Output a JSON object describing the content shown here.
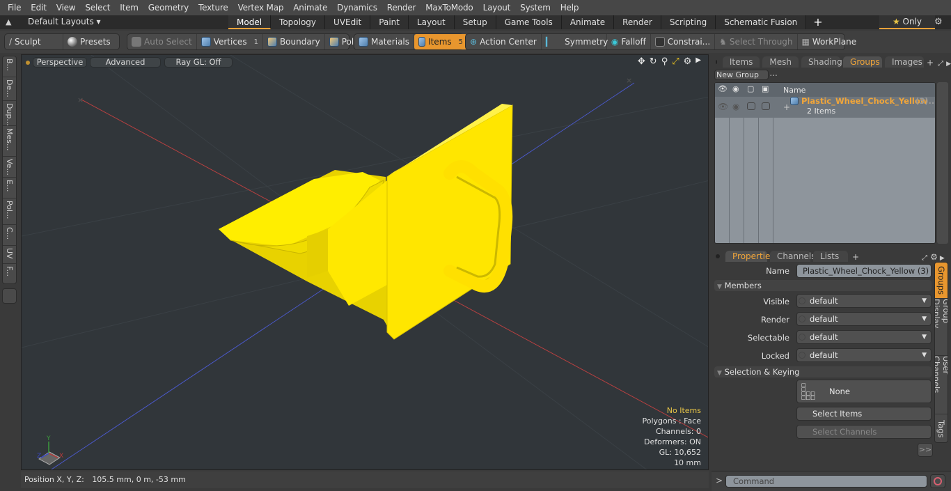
{
  "menu": [
    "File",
    "Edit",
    "View",
    "Select",
    "Item",
    "Geometry",
    "Texture",
    "Vertex Map",
    "Animate",
    "Dynamics",
    "Render",
    "MaxToModo",
    "Layout",
    "System",
    "Help"
  ],
  "layoutbar": {
    "layouts_label": "Default Layouts ▾",
    "tabs": [
      "Model",
      "Topology",
      "UVEdit",
      "Paint",
      "Layout",
      "Setup",
      "Game Tools",
      "Animate",
      "Render",
      "Scripting",
      "Schematic Fusion"
    ],
    "active_tab": "Model",
    "add_tab": "+",
    "only_label": "Only"
  },
  "toolbar": {
    "sculpt": "Sculpt",
    "presets": "Presets",
    "auto_select": "Auto Select",
    "vertices": "Vertices",
    "vertices_count": "1",
    "boundary": "Boundary",
    "polygons": "Polygons",
    "materials": "Materials",
    "items": "Items",
    "items_count": "5",
    "action_center": "Action Center",
    "symmetry": "Symmetry",
    "falloff": "Falloff",
    "constraints": "Constrai...",
    "select_through": "Select Through",
    "workplane": "WorkPlane"
  },
  "left_tabs": [
    "B...",
    "De...",
    "Dup...",
    "Mes...",
    "Ve...",
    "E...",
    "Pol...",
    "C...",
    "UV",
    "F..."
  ],
  "viewport": {
    "view_mode": "Perspective",
    "shading": "Advanced",
    "raygl": "Ray GL: Off",
    "info": {
      "items": "No Items",
      "polygons": "Polygons : Face",
      "channels": "Channels: 0",
      "deformers": "Deformers: ON",
      "gl": "GL: 10,652",
      "scale": "10 mm"
    },
    "axis_labels": {
      "x": "X",
      "y": "Y",
      "z": "Z"
    },
    "object_color": "#ffe800"
  },
  "status": {
    "position_label": "Position X, Y, Z:",
    "position_value": "105.5 mm, 0 m, -53 mm"
  },
  "groups_panel": {
    "tabs": [
      "Items",
      "Mesh ...",
      "Shading",
      "Groups",
      "Images"
    ],
    "active_tab": "Groups",
    "new_group": "New Group",
    "column_name": "Name",
    "group": {
      "name": "Plastic_Wheel_Chock_Yellow",
      "suffix": "(3)...",
      "items_count": "2 Items"
    }
  },
  "properties_panel": {
    "tabs": [
      "Properties",
      "Channels",
      "Lists"
    ],
    "active_tab": "Properties",
    "name_label": "Name",
    "name_value": "Plastic_Wheel_Chock_Yellow (3)",
    "members_section": "Members",
    "fields": [
      {
        "label": "Visible",
        "value": "default"
      },
      {
        "label": "Render",
        "value": "default"
      },
      {
        "label": "Selectable",
        "value": "default"
      },
      {
        "label": "Locked",
        "value": "default"
      }
    ],
    "selection_section": "Selection & Keying",
    "none_label": "None",
    "select_items": "Select Items",
    "select_channels": "Select Channels",
    "more": ">>",
    "side_tabs": [
      "Groups",
      "Group Display",
      "User Channels",
      "Tags"
    ]
  },
  "command": {
    "prompt": ">",
    "placeholder": "Command"
  },
  "colors": {
    "accent": "#e8962e",
    "highlight_text": "#e8c547",
    "group_name": "#f0a53a"
  }
}
